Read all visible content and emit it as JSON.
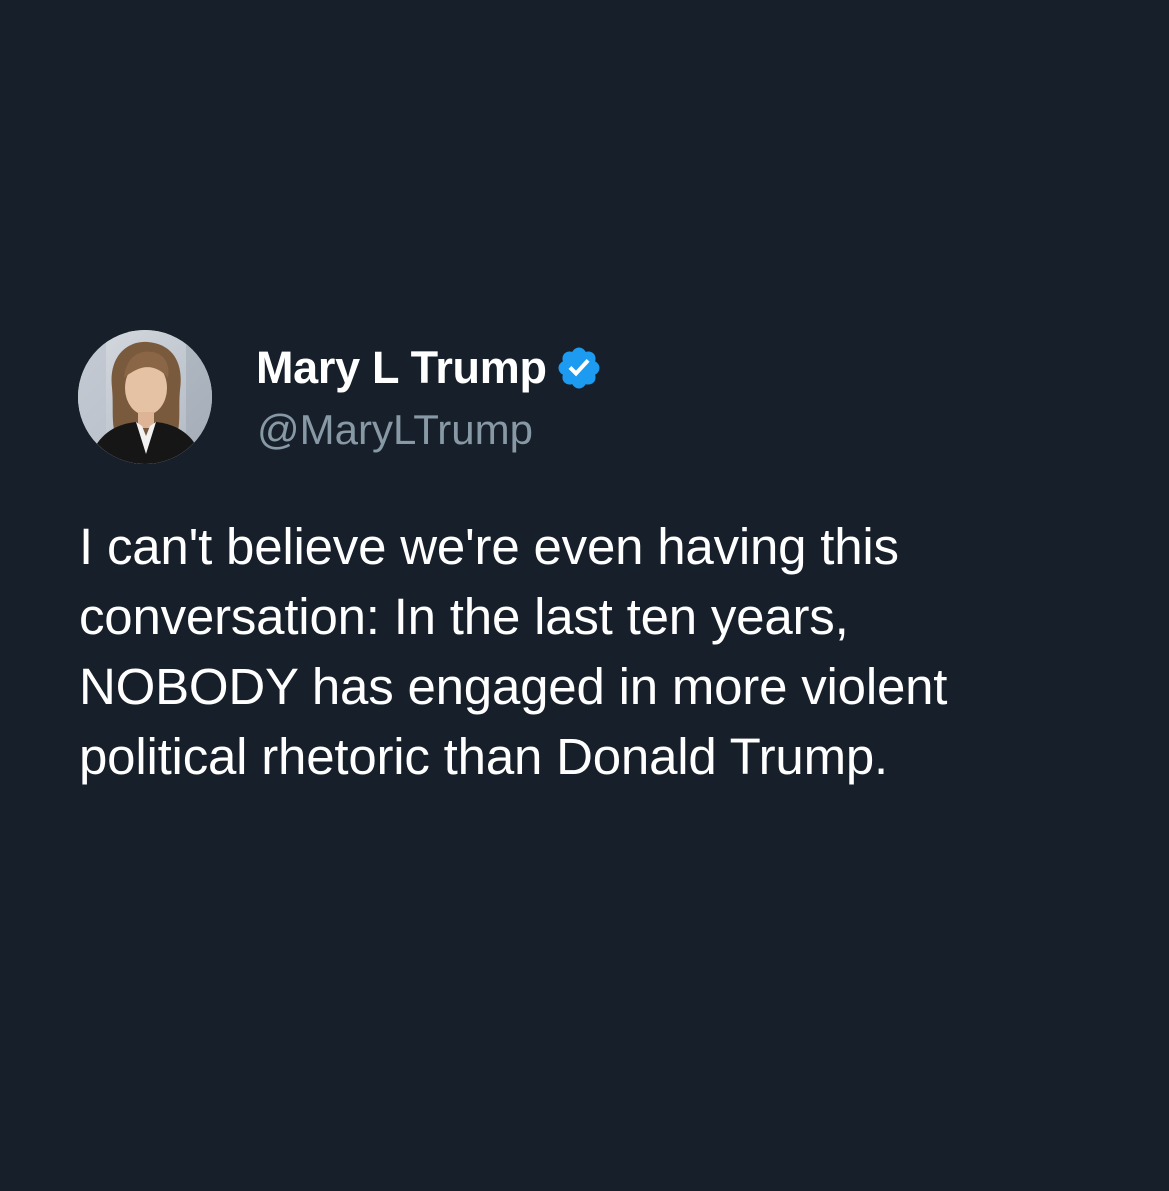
{
  "tweet": {
    "author": {
      "name": "Mary L Trump",
      "handle": "@MaryLTrump",
      "verified": true,
      "verified_icon": "verified-badge-icon",
      "avatar": "author-avatar"
    },
    "text": "I can't believe we're even having this conversation: In the last ten years, NOBODY has engaged in more violent political rhetoric than Donald Trump."
  },
  "colors": {
    "background": "#17202a",
    "name_text": "#ffffff",
    "handle_text": "#8899a6",
    "body_text": "#ffffff",
    "verified_badge": "#1d9bf0"
  }
}
